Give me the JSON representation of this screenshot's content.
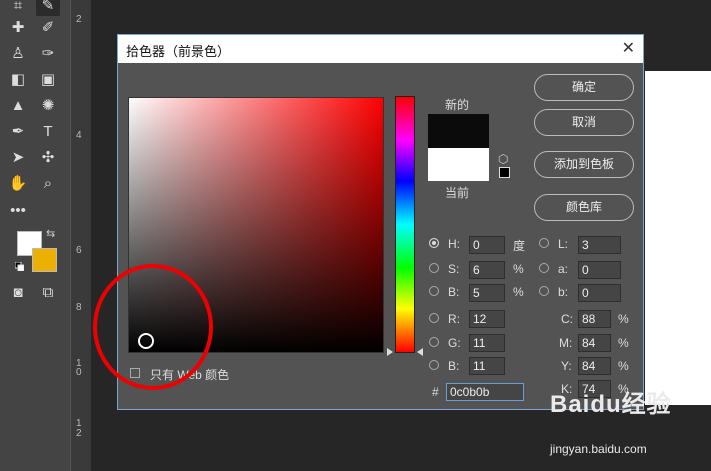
{
  "dialog": {
    "title": "拾色器（前景色）",
    "close_glyph": "✕",
    "new_label": "新的",
    "current_label": "当前",
    "ok_label": "确定",
    "cancel_label": "取消",
    "add_swatch_label": "添加到色板",
    "libraries_label": "颜色库",
    "only_web_label": "只有 Web 颜色",
    "new_color": "#0c0b0b",
    "current_color": "#ffffff",
    "fields": {
      "H": {
        "label": "H:",
        "value": "0",
        "unit": "度",
        "selected": true
      },
      "S": {
        "label": "S:",
        "value": "6",
        "unit": "%"
      },
      "Bv": {
        "label": "B:",
        "value": "5",
        "unit": "%"
      },
      "R": {
        "label": "R:",
        "value": "12"
      },
      "G": {
        "label": "G:",
        "value": "11"
      },
      "Bc": {
        "label": "B:",
        "value": "11"
      },
      "L": {
        "label": "L:",
        "value": "3"
      },
      "a": {
        "label": "a:",
        "value": "0"
      },
      "b": {
        "label": "b:",
        "value": "0"
      },
      "C": {
        "label": "C:",
        "value": "88",
        "unit": "%"
      },
      "M": {
        "label": "M:",
        "value": "84",
        "unit": "%"
      },
      "Y": {
        "label": "Y:",
        "value": "84",
        "unit": "%"
      },
      "K": {
        "label": "K:",
        "value": "74",
        "unit": "%"
      }
    },
    "hex_prefix": "#",
    "hex_value": "0c0b0b"
  },
  "toolbox": {
    "foreground_color": "#ffffff",
    "background_color": "#ebb000",
    "tools": [
      "crop-icon",
      "eyedropper-icon",
      "healing-icon",
      "brush-icon",
      "stamp-icon",
      "history-brush-icon",
      "eraser-icon",
      "gradient-icon",
      "blur-icon",
      "sponge-icon",
      "pen-icon",
      "type-icon",
      "path-select-icon",
      "shape-icon",
      "hand-icon",
      "zoom-icon",
      "more-icon"
    ]
  },
  "ruler": {
    "numbers": [
      "2",
      "4",
      "6",
      "8",
      "1",
      "0",
      "1",
      "2"
    ]
  },
  "watermark": {
    "logo": "Baidu经验",
    "url": "jingyan.baidu.com"
  }
}
